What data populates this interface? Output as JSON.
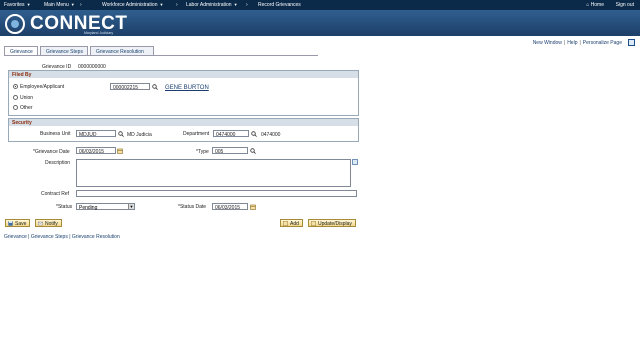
{
  "topnav": {
    "favorites": "Favorites",
    "main_menu": "Main Menu",
    "workforce_admin": "Workforce Administration",
    "labor_admin": "Labor Administration",
    "record_grievances": "Record Grievances",
    "home": "Home",
    "sign_out": "Sign out"
  },
  "banner": {
    "logo_text": "CONNECT",
    "logo_sub": "Maryland Judiciary"
  },
  "toplinks": {
    "new_window": "New Window",
    "help": "Help",
    "personalize": "Personalize Page"
  },
  "tabs": [
    "Grievance",
    "Grievance Steps",
    "Grievance Resolution"
  ],
  "grievance_id": {
    "label": "Grievance ID",
    "value": "0000000000"
  },
  "filed_by": {
    "heading": "Filed By",
    "options": [
      "Employee/Applicant",
      "Union",
      "Other"
    ],
    "selected": "Employee/Applicant",
    "employee_id": "000002215",
    "employee_name": "GENE BURTON"
  },
  "security": {
    "heading": "Security",
    "business_unit_label": "Business Unit",
    "business_unit": "MDJUD",
    "business_unit_desc": "MD Judicia",
    "department_label": "Department",
    "department": "0474000",
    "department_desc": "0474000"
  },
  "form": {
    "grievance_date_label": "*Grievance Date",
    "grievance_date": "06/03/2015",
    "type_label": "*Type",
    "type": "005",
    "description_label": "Description",
    "description": "",
    "contract_ref_label": "Contract Ref",
    "contract_ref": "",
    "status_label": "*Status",
    "status": "Pending",
    "status_date_label": "*Status Date",
    "status_date": "06/03/2015"
  },
  "buttons": {
    "save": "Save",
    "notify": "Notify",
    "add": "Add",
    "update_display": "Update/Display"
  },
  "bottomlinks": [
    "Grievance",
    "Grievance Steps",
    "Grievance Resolution"
  ],
  "colors": {
    "nav_bg": "#0b2a4a",
    "banner": "#2f5f8f",
    "group_head_text": "#8a2b0a",
    "link": "#1a3f6f"
  }
}
